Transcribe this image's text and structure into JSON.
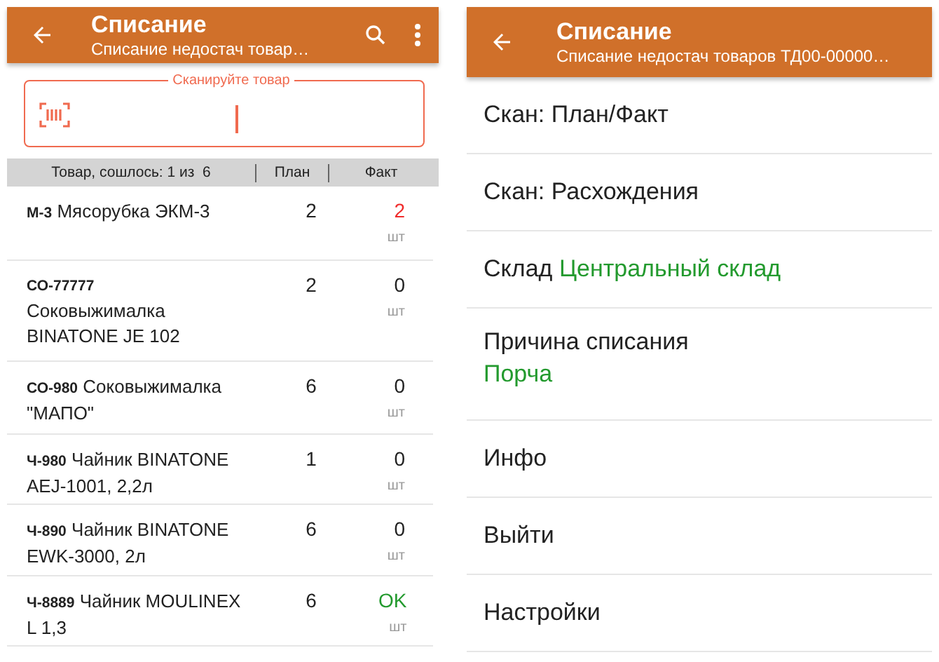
{
  "left_screen": {
    "app_bar": {
      "title": "Списание",
      "subtitle": "Списание недостач товар…"
    },
    "scan_field": {
      "label": "Сканируйте товар"
    },
    "table": {
      "columns": [
        "Товар, сошлось: 1 из  6",
        "План",
        "Факт"
      ],
      "rows": [
        {
          "code": "М-3",
          "name": "Мясорубка ЭКМ-3",
          "plan": "2",
          "fact": "2",
          "unit": "шт",
          "color": "#f02b2b",
          "code_line": false
        },
        {
          "code": "СО-77777",
          "name": "Соковыжималка BINATONE JE 102",
          "plan": "2",
          "fact": "0",
          "unit": "шт",
          "color": "#222222",
          "code_line": true
        },
        {
          "code": "СО-980",
          "name": "Соковыжималка \"МАПО\"",
          "plan": "6",
          "fact": "0",
          "unit": "шт",
          "color": "#222222",
          "code_line": false
        },
        {
          "code": "Ч-980",
          "name": "Чайник BINATONE AEJ-1001, 2,2л",
          "plan": "1",
          "fact": "0",
          "unit": "шт",
          "color": "#222222",
          "code_line": false
        },
        {
          "code": "Ч-890",
          "name": "Чайник BINATONE EWK-3000, 2л",
          "plan": "6",
          "fact": "0",
          "unit": "шт",
          "color": "#222222",
          "code_line": false
        },
        {
          "code": "Ч-8889",
          "name": "Чайник MOULINEX L 1,3",
          "plan": "6",
          "fact": "OK",
          "unit": "шт",
          "color": "#239a2e",
          "code_line": false
        }
      ]
    }
  },
  "right_screen": {
    "app_bar": {
      "title": "Списание",
      "subtitle": "Списание недостач товаров ТД00-00000…"
    },
    "menu": [
      {
        "kind": "plain",
        "label": "Скан: План/Факт"
      },
      {
        "kind": "plain",
        "label": "Скан: Расхождения"
      },
      {
        "kind": "inline",
        "label": "Склад",
        "value": "Центральный склад"
      },
      {
        "kind": "stacked",
        "label": "Причина списания",
        "value": "Порча"
      },
      {
        "kind": "plain",
        "label": "Инфо"
      },
      {
        "kind": "plain",
        "label": "Выйти"
      },
      {
        "kind": "plain",
        "label": "Настройки"
      }
    ]
  }
}
